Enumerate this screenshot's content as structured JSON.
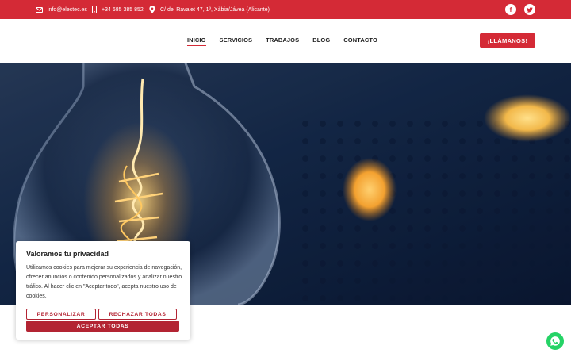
{
  "topbar": {
    "email": "info@electec.es",
    "phone": "+34 685 385 852",
    "address": "C/ del Ravalet 47, 1º, Xàbia/Jávea (Alicante)",
    "social": [
      {
        "icon": "facebook-icon",
        "glyph": "f"
      },
      {
        "icon": "twitter-icon",
        "glyph": "t"
      }
    ]
  },
  "nav": {
    "items": [
      "INICIO",
      "SERVICIOS",
      "TRABAJOS",
      "BLOG",
      "CONTACTO"
    ],
    "active": "INICIO",
    "call_label": "¡LLÁMANOS!"
  },
  "cookie": {
    "title": "Valoramos tu privacidad",
    "text": "Utilizamos cookies para mejorar su experiencia de navegación, ofrecer anuncios o contenido personalizados y analizar nuestro tráfico. Al hacer clic en \"Aceptar todo\", acepta nuestro uso de cookies.",
    "customize_label": "PERSONALIZAR",
    "reject_label": "RECHAZAR TODAS",
    "accept_label": "ACEPTAR TODAS"
  },
  "colors": {
    "brand_red": "#d42a36",
    "button_red": "#b32433",
    "whatsapp_green": "#25d366"
  }
}
